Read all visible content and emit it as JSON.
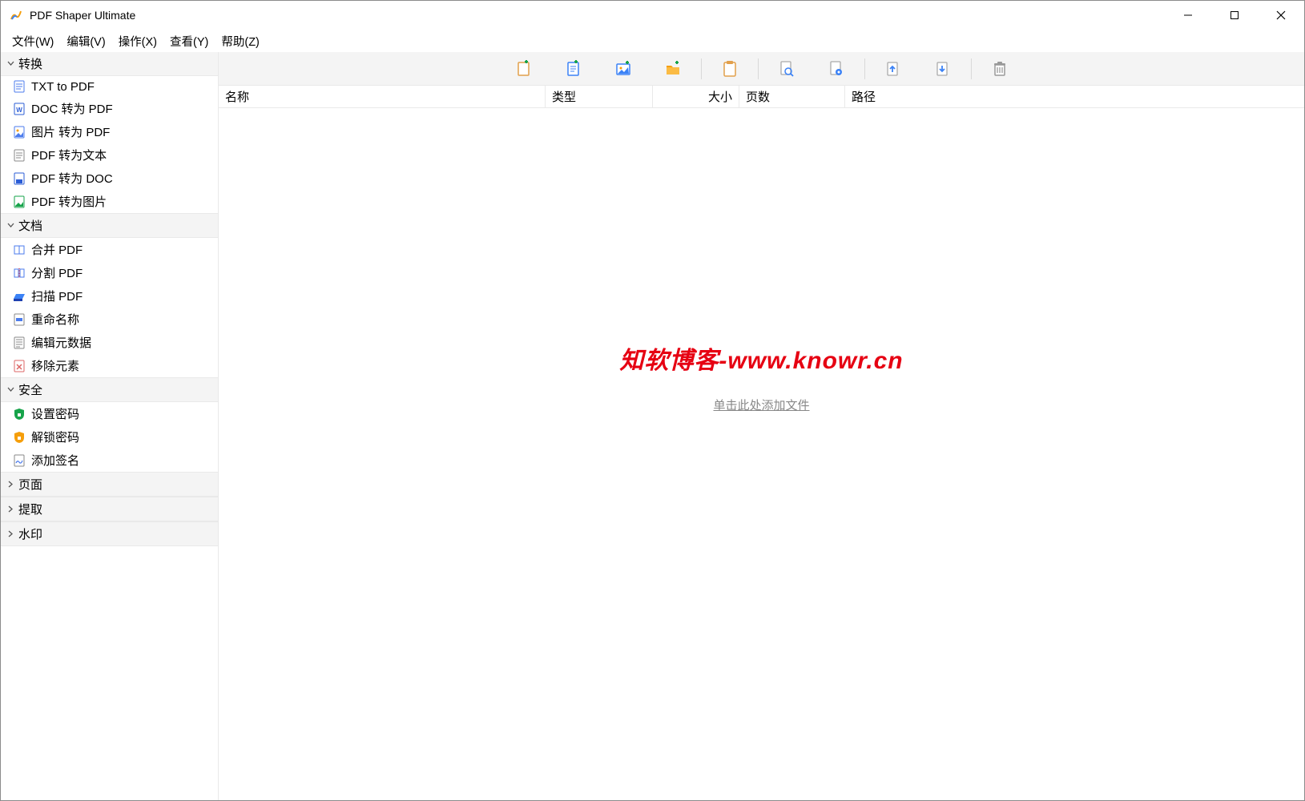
{
  "window": {
    "title": "PDF Shaper Ultimate"
  },
  "menubar": {
    "file": "文件(W)",
    "edit": "编辑(V)",
    "action": "操作(X)",
    "view": "查看(Y)",
    "help": "帮助(Z)"
  },
  "sidebar": {
    "groups": {
      "convert": {
        "label": "转换",
        "expanded": true
      },
      "document": {
        "label": "文档",
        "expanded": true
      },
      "security": {
        "label": "安全",
        "expanded": true
      },
      "page": {
        "label": "页面",
        "expanded": false
      },
      "extract": {
        "label": "提取",
        "expanded": false
      },
      "watermark": {
        "label": "水印",
        "expanded": false
      }
    },
    "convert": {
      "txt_to_pdf": "TXT to PDF",
      "doc_to_pdf": "DOC 转为 PDF",
      "img_to_pdf": "图片 转为 PDF",
      "pdf_to_txt": "PDF 转为文本",
      "pdf_to_doc": "PDF 转为 DOC",
      "pdf_to_img": "PDF 转为图片"
    },
    "document": {
      "merge": "合并 PDF",
      "split": "分割 PDF",
      "scan": "扫描 PDF",
      "rename": "重命名称",
      "metadata": "编辑元数据",
      "remove": "移除元素"
    },
    "security": {
      "set_pwd": "设置密码",
      "unlock_pwd": "解锁密码",
      "add_sign": "添加签名"
    }
  },
  "toolbar": {
    "add_file": "add-file-icon",
    "add_text": "add-text-icon",
    "add_image": "add-image-icon",
    "add_folder": "add-folder-icon",
    "clipboard": "clipboard-icon",
    "page_preview": "page-preview-icon",
    "page_settings": "page-settings-icon",
    "move_up": "move-up-icon",
    "move_down": "move-down-icon",
    "delete": "trash-icon"
  },
  "columns": {
    "name": "名称",
    "type": "类型",
    "size": "大小",
    "pages": "页数",
    "path": "路径"
  },
  "main": {
    "watermark_text": "知软博客-www.knowr.cn",
    "empty_hint": "单击此处添加文件"
  }
}
